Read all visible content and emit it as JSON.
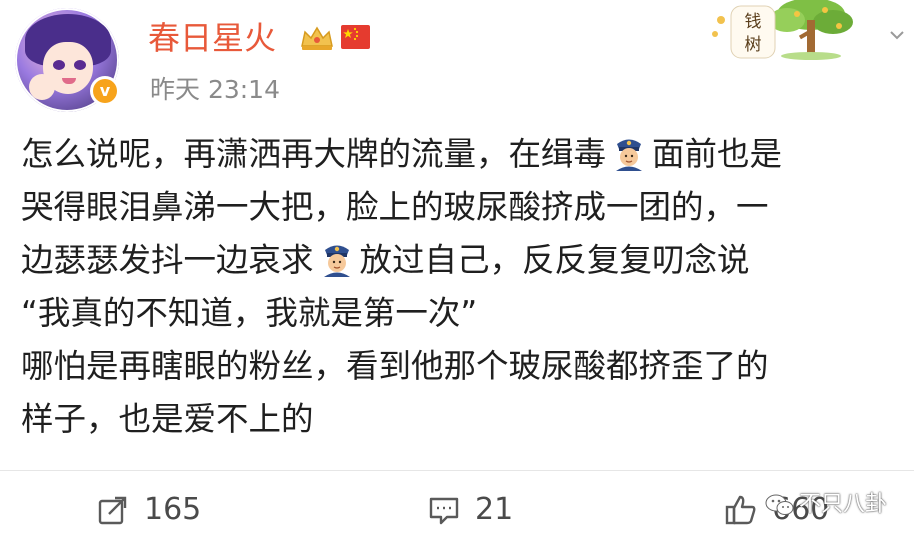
{
  "user": {
    "name": "春日星火",
    "badge_letter": "v",
    "timestamp": "昨天 23:14"
  },
  "decoration": {
    "tree_text": "钱\n树",
    "icon": "money-tree-icon"
  },
  "post": {
    "lines": [
      {
        "before": "怎么说呢，再潇洒再大牌的流量，在缉毒",
        "after": "面前也是"
      },
      {
        "text": "哭得眼泪鼻涕一大把，脸上的玻尿酸挤成一团的，一"
      },
      {
        "before": "边瑟瑟发抖一边哀求",
        "after": "放过自己，反反复复叨念说"
      },
      {
        "text": "“我真的不知道，我就是第一次”"
      },
      {
        "text": "哪怕是再瞎眼的粉丝，看到他那个玻尿酸都挤歪了的"
      },
      {
        "text": "样子，也是爱不上的"
      }
    ]
  },
  "actions": {
    "repost_count": "165",
    "comment_count": "21",
    "like_count": "660"
  },
  "watermark": {
    "text": "不只八卦"
  },
  "colors": {
    "username": "#e8593a",
    "timestamp": "#8a8a8a",
    "verify": "#f7a31b"
  }
}
